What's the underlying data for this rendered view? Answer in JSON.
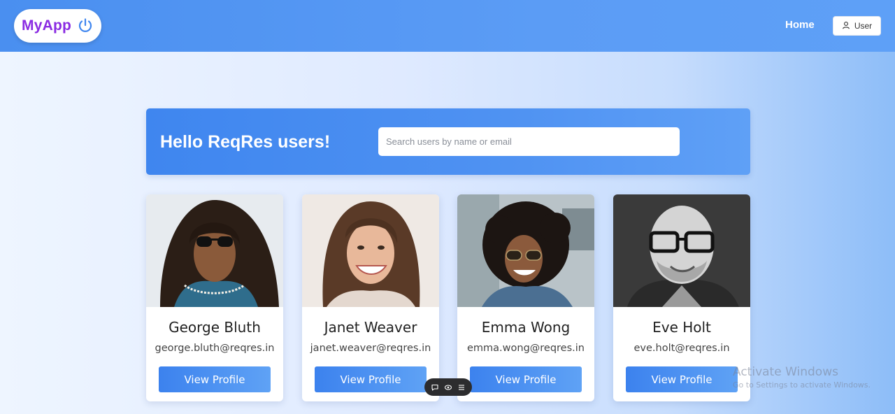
{
  "header": {
    "logo_text": "MyApp",
    "logo_icon": "power-icon",
    "nav_home": "Home",
    "user_button": "User",
    "user_icon": "user-icon",
    "colors": {
      "bar": "#4a8ff0",
      "logo": "#8a2be2"
    }
  },
  "hero": {
    "title": "Hello ReqRes users!",
    "search_placeholder": "Search users by name or email",
    "search_value": ""
  },
  "users": [
    {
      "name": "George Bluth",
      "email": "george.bluth@reqres.in",
      "button": "View Profile"
    },
    {
      "name": "Janet Weaver",
      "email": "janet.weaver@reqres.in",
      "button": "View Profile"
    },
    {
      "name": "Emma Wong",
      "email": "emma.wong@reqres.in",
      "button": "View Profile"
    },
    {
      "name": "Eve Holt",
      "email": "eve.holt@reqres.in",
      "button": "View Profile"
    }
  ],
  "floating_toolbar": {
    "icons": [
      "chat-icon",
      "eye-icon",
      "menu-icon"
    ]
  },
  "watermark": {
    "title": "Activate Windows",
    "subtitle": "Go to Settings to activate Windows."
  }
}
